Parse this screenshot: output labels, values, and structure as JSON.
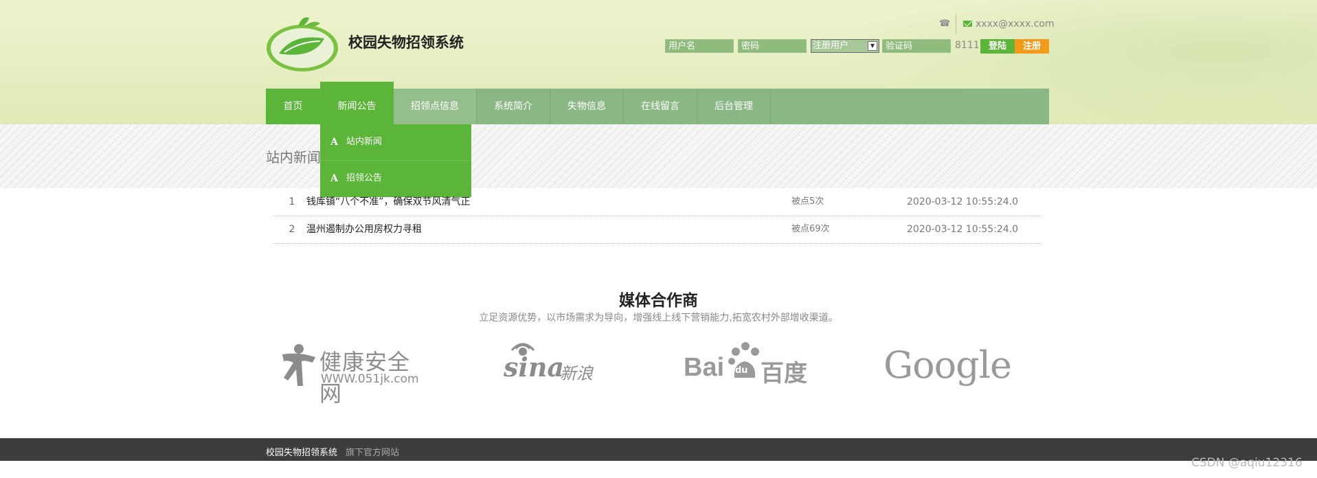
{
  "site": {
    "title": "校园失物招领系统"
  },
  "contact": {
    "email": "xxxx@xxxx.com"
  },
  "login": {
    "username_placeholder": "用户名",
    "password_placeholder": "密码",
    "role_selected": "注册用户",
    "captcha_placeholder": "验证码",
    "captcha_code": "8111",
    "login_label": "登陆",
    "register_label": "注册"
  },
  "nav": {
    "items": [
      "首页",
      "新闻公告",
      "招领点信息",
      "系统简介",
      "失物信息",
      "在线留言",
      "后台管理"
    ],
    "dropdown": [
      "站内新闻",
      "招领公告"
    ]
  },
  "section": {
    "title": "站内新闻"
  },
  "news": [
    {
      "num": "1",
      "title": "钱库镇“八个不准”，确保双节风清气正",
      "clicks": "被点5次",
      "date": "2020-03-12 10:55:24.0"
    },
    {
      "num": "2",
      "title": "温州遏制办公用房权力寻租",
      "clicks": "被点69次",
      "date": "2020-03-12 10:55:24.0"
    }
  ],
  "partners": {
    "title": "媒体合作商",
    "subtitle": "立足资源优势，以市场需求为导向，增强线上线下营销能力,拓宽农村外部增收渠道。",
    "logos": [
      {
        "name": "健康安全网",
        "url_text": "WWW.051jk.com"
      },
      {
        "name": "sina",
        "cn": "新浪"
      },
      {
        "name": "Bai",
        "du": "du",
        "cn": "百度"
      },
      {
        "name": "Google"
      }
    ]
  },
  "footer": {
    "name": "校园失物招领系统",
    "tagline": "旗下官方网站"
  },
  "watermark": "CSDN @aqiu12316",
  "colors": {
    "green": "#5bb538",
    "nav": "#8ab884",
    "orange": "#f39a1b",
    "footer": "#3d3d3d"
  }
}
